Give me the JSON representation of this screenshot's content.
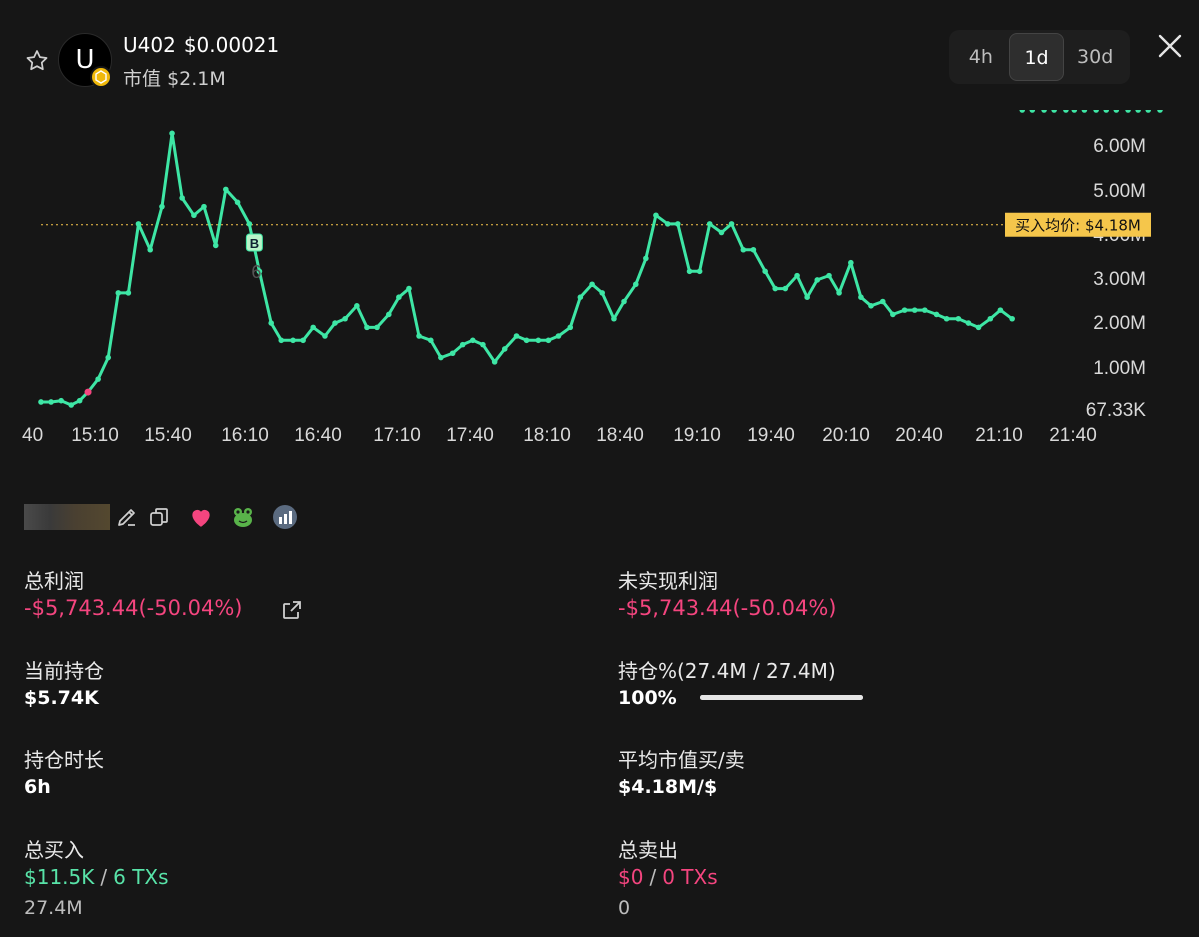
{
  "token": {
    "symbol": "U402",
    "price": "$0.00021",
    "mcap_label": "市值",
    "mcap_value": "$2.1M",
    "avatar_letter": "U",
    "badge_color": "#f0b90b"
  },
  "timeframes": [
    "4h",
    "1d",
    "30d"
  ],
  "selected_timeframe": "1d",
  "chart_data": {
    "type": "line",
    "x_labels": [
      "15:10",
      "15:40",
      "16:10",
      "16:40",
      "17:10",
      "17:40",
      "18:10",
      "18:40",
      "19:10",
      "19:40",
      "20:10",
      "20:40",
      "21:10",
      "21:40"
    ],
    "left_cut_label": "40",
    "y_tick_labels": [
      "6.00M",
      "5.00M",
      "4.00M",
      "3.00M",
      "2.00M",
      "1.00M",
      "67.33K"
    ],
    "y_ticks": [
      6.0,
      5.0,
      4.0,
      3.0,
      2.0,
      1.0,
      0.06733
    ],
    "ylim": [
      0.06733,
      6.4
    ],
    "x_range": [
      0,
      26
    ],
    "x_tick_positions": [
      2,
      4,
      6,
      8,
      10,
      12,
      14,
      16,
      18,
      20,
      22,
      24,
      26,
      28
    ],
    "line_color": "#3ee6a5",
    "avg_buy_price": 4.18,
    "avg_buy_label": "买入均价: $4.18M",
    "avg_buy_color": "#f5c64b",
    "buy_marker_label": "B",
    "buy_marker_x": 6.35,
    "buy_marker_sub": "6",
    "sell_marker_x": 1.4,
    "x": [
      0.0,
      0.3,
      0.6,
      0.9,
      1.15,
      1.4,
      1.7,
      2.0,
      2.3,
      2.6,
      2.9,
      3.25,
      3.6,
      3.9,
      4.2,
      4.55,
      4.85,
      5.2,
      5.5,
      5.85,
      6.2,
      6.5,
      6.85,
      7.15,
      7.5,
      7.8,
      8.1,
      8.45,
      8.75,
      9.05,
      9.4,
      9.7,
      10.0,
      10.35,
      10.65,
      10.95,
      11.25,
      11.6,
      11.9,
      12.25,
      12.55,
      12.85,
      13.15,
      13.5,
      13.8,
      14.15,
      14.45,
      14.8,
      15.1,
      15.4,
      15.75,
      16.05,
      16.4,
      16.7,
      17.05,
      17.35,
      17.7,
      18.0,
      18.3,
      18.65,
      18.95,
      19.3,
      19.6,
      19.9,
      20.25,
      20.55,
      20.9,
      21.2,
      21.55,
      21.85,
      22.15,
      22.5,
      22.8,
      23.1,
      23.45,
      23.75,
      24.1,
      24.4,
      24.7,
      25.05,
      25.35,
      25.7,
      26.0,
      26.3,
      26.65,
      26.95,
      27.3,
      27.6,
      27.9,
      28.25,
      28.55,
      28.9,
      29.2,
      29.5,
      29.85,
      30.15,
      30.5,
      30.75,
      31.05,
      31.4,
      31.7,
      32.0,
      32.35,
      32.65,
      32.95,
      33.3
    ],
    "values": [
      0.07,
      0.07,
      0.1,
      0.0,
      0.1,
      0.3,
      0.6,
      1.1,
      2.6,
      2.6,
      4.2,
      3.6,
      4.6,
      6.3,
      4.8,
      4.4,
      4.6,
      3.7,
      5.0,
      4.7,
      4.2,
      3.1,
      1.9,
      1.5,
      1.5,
      1.5,
      1.8,
      1.6,
      1.9,
      2.0,
      2.3,
      1.8,
      1.8,
      2.1,
      2.5,
      2.7,
      1.6,
      1.5,
      1.1,
      1.2,
      1.4,
      1.5,
      1.4,
      1.0,
      1.3,
      1.6,
      1.5,
      1.5,
      1.5,
      1.6,
      1.8,
      2.5,
      2.8,
      2.6,
      2.0,
      2.4,
      2.8,
      3.4,
      4.4,
      4.2,
      4.2,
      3.1,
      3.1,
      4.2,
      4.0,
      4.2,
      3.6,
      3.6,
      3.1,
      2.7,
      2.7,
      3.0,
      2.5,
      2.9,
      3.0,
      2.6,
      3.3,
      2.5,
      2.3,
      2.4,
      2.1,
      2.2,
      2.2,
      2.2,
      2.1,
      2.0,
      2.0,
      1.9,
      1.8,
      2.0,
      2.2,
      2.0
    ]
  },
  "profile": {
    "icons": [
      "edit-icon",
      "copy-icon",
      "heart-icon",
      "frog-icon",
      "chart-badge-icon"
    ],
    "heart_color": "#f4457f"
  },
  "stats": {
    "total_profit_label": "总利润",
    "total_profit_value": "-$5,743.44(-50.04%)",
    "unrealized_label": "未实现利润",
    "unrealized_value": "-$5,743.44(-50.04%)",
    "position_label": "当前持仓",
    "position_value": "$5.74K",
    "holding_pct_label": "持仓%(27.4M / 27.4M)",
    "holding_pct_value": "100%",
    "holding_pct_fill": 1.0,
    "duration_label": "持仓时长",
    "duration_value": "6h",
    "avg_mcap_label": "平均市值买/卖",
    "avg_mcap_value": "$4.18M/$",
    "total_buy_label": "总买入",
    "total_buy_amount": "$11.5K",
    "total_buy_txs": "6 TXs",
    "total_buy_qty": "27.4M",
    "total_sell_label": "总卖出",
    "total_sell_amount": "$0",
    "total_sell_txs": "0 TXs",
    "total_sell_qty": "0",
    "separator": "/"
  },
  "colors": {
    "negative": "#f4457f",
    "positive": "#58e3a8",
    "background": "#161616"
  }
}
